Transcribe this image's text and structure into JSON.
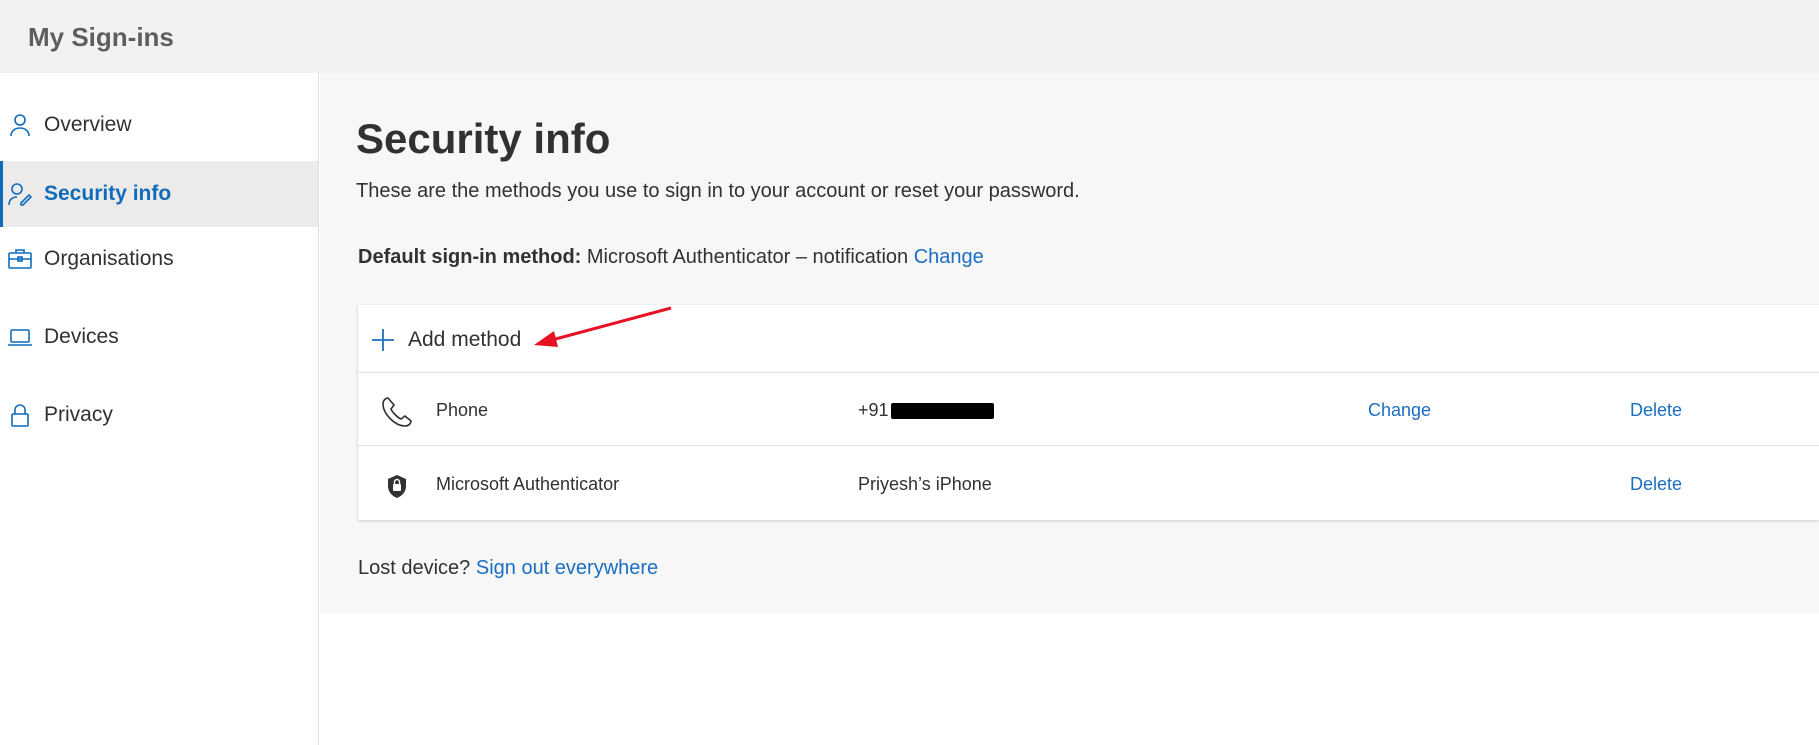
{
  "app": {
    "title": "My Sign-ins"
  },
  "sidebar": {
    "items": [
      {
        "label": "Overview",
        "icon": "person-icon",
        "active": false
      },
      {
        "label": "Security info",
        "icon": "person-key-icon",
        "active": true
      },
      {
        "label": "Organisations",
        "icon": "briefcase-icon",
        "active": false
      },
      {
        "label": "Devices",
        "icon": "laptop-icon",
        "active": false
      },
      {
        "label": "Privacy",
        "icon": "lock-icon",
        "active": false
      }
    ]
  },
  "main": {
    "title": "Security info",
    "subtitle": "These are the methods you use to sign in to your account or reset your password.",
    "default_method": {
      "label": "Default sign-in method:",
      "value": "Microsoft Authenticator – notification",
      "change_label": "Change"
    },
    "add_method_label": "Add method",
    "methods": [
      {
        "name": "Phone",
        "detail": "+91",
        "detail_redacted": true,
        "change_label": "Change",
        "delete_label": "Delete",
        "icon": "phone-icon"
      },
      {
        "name": "Microsoft Authenticator",
        "detail": "Priyesh’s iPhone",
        "change_label": "",
        "delete_label": "Delete",
        "icon": "authenticator-lock-icon"
      }
    ],
    "lost_device": {
      "label": "Lost device?",
      "link": "Sign out everywhere"
    }
  },
  "colors": {
    "accent": "#0f6cbd",
    "link": "#1b6ec2",
    "annotation_arrow": "#e81123",
    "topbar_bg": "#f3f2f1",
    "main_bg": "#f7f7f7"
  }
}
